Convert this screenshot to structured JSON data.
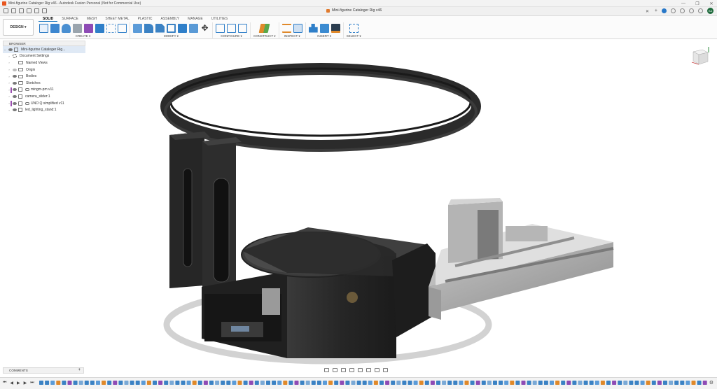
{
  "titlebar": {
    "title": "Mini-figurine Cataloger Rig v46 - Autodesk Fusion Personal (Not for Commercial Use)",
    "controls": [
      "—",
      "❐",
      "✕"
    ]
  },
  "doc_tab": {
    "label": "Mini-figurine Cataloger Rig v46",
    "close": "✕"
  },
  "user": {
    "initials": "KA"
  },
  "ribbon": {
    "workspace": "DESIGN ▾",
    "tabs": [
      "SOLID",
      "SURFACE",
      "MESH",
      "SHEET METAL",
      "PLASTIC",
      "ASSEMBLY",
      "MANAGE",
      "UTILITIES"
    ],
    "groups": [
      {
        "label": "CREATE ▾",
        "icons": [
          "new-sketch-icon",
          "extrude-icon",
          "revolve-icon",
          "hole-icon",
          "create-form-icon",
          "box-icon",
          "pattern-icon",
          "sketch-rect-icon"
        ]
      },
      {
        "label": "MODIFY ▾",
        "icons": [
          "press-pull-icon",
          "fillet-icon",
          "chamfer-icon",
          "shell-icon",
          "combine-icon",
          "move-icon",
          "align-icon"
        ]
      },
      {
        "label": "CONFIGURE ▾",
        "icons": [
          "configure-table-icon",
          "configure-rule-icon",
          "configure-info-icon"
        ]
      },
      {
        "label": "CONSTRUCT ▾",
        "icons": [
          "plane-icon"
        ]
      },
      {
        "label": "INSPECT ▾",
        "icons": [
          "measure-icon",
          "section-icon"
        ]
      },
      {
        "label": "INSERT ▾",
        "icons": [
          "insert-derive-icon",
          "insert-image-icon",
          "insert-mesh-icon"
        ]
      },
      {
        "label": "SELECT ▾",
        "icons": [
          "select-icon"
        ]
      }
    ]
  },
  "browser": {
    "header": "BROWSER",
    "root": "Mini-figurine Cataloger Rig...",
    "items": [
      {
        "label": "Document Settings",
        "type": "gear"
      },
      {
        "label": "Named Views",
        "type": "folder"
      },
      {
        "label": "Origin",
        "type": "folder"
      },
      {
        "label": "Bodies",
        "type": "folder"
      },
      {
        "label": "Sketches",
        "type": "folder"
      },
      {
        "label": "mingm-pm v11",
        "type": "link"
      },
      {
        "label": "camera_slider:1",
        "type": "comp"
      },
      {
        "label": "UNO Q simplified v11",
        "type": "link"
      },
      {
        "label": "led_lighting_stand:1",
        "type": "comp"
      }
    ]
  },
  "comments": {
    "label": "COMMENTS",
    "add": "+"
  },
  "colors": {
    "accent": "#0a6ebd",
    "model_dark": "#2c2c2c",
    "model_frame": "#a7a7a7",
    "component_marker": "#9b4fb0"
  }
}
